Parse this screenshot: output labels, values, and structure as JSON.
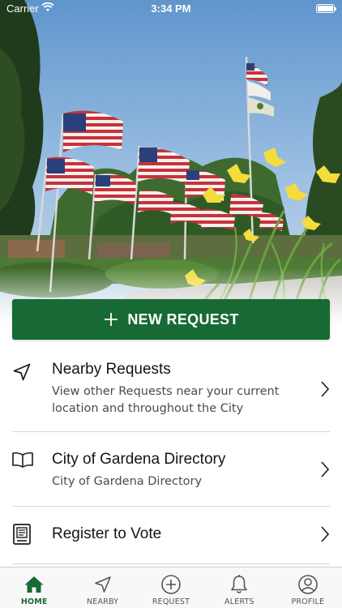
{
  "status_bar": {
    "carrier": "Carrier",
    "time": "3:34 PM"
  },
  "hero": {
    "image_subject": "Flags flying over Gardena park with yellow daylilies"
  },
  "new_request": {
    "label": "NEW REQUEST",
    "icon": "plus-icon",
    "color": "#176a34"
  },
  "menu": [
    {
      "title": "Nearby Requests",
      "description": "View other Requests near your current location and throughout the City",
      "icon": "location-arrow-icon"
    },
    {
      "title": "City of Gardena Directory",
      "description": "City of Gardena Directory",
      "icon": "open-book-icon"
    },
    {
      "title": "Register to Vote",
      "description": "",
      "icon": "ballot-document-icon"
    }
  ],
  "tab_bar": {
    "active": "HOME",
    "accent": "#176a34",
    "tabs": [
      {
        "label": "HOME",
        "icon": "home-icon"
      },
      {
        "label": "NEARBY",
        "icon": "location-arrow-icon"
      },
      {
        "label": "REQUEST",
        "icon": "plus-circle-icon"
      },
      {
        "label": "ALERTS",
        "icon": "bell-icon"
      },
      {
        "label": "PROFILE",
        "icon": "user-circle-icon"
      }
    ]
  }
}
